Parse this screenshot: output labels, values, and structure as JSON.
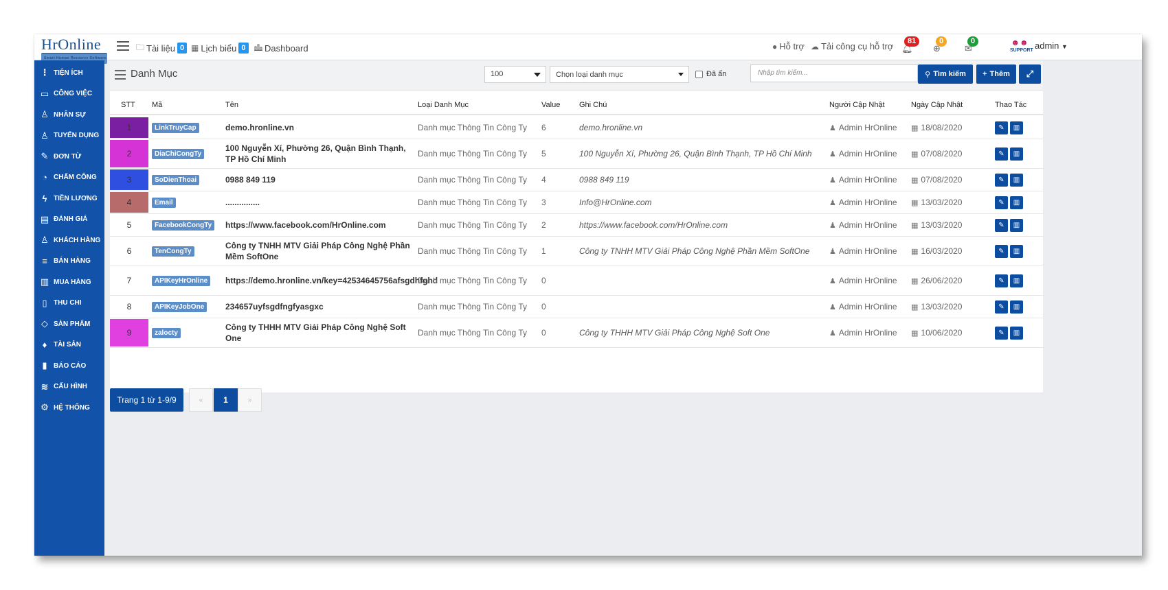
{
  "brand": {
    "logo": "HrOnline",
    "tagline": "Smart Human Resource Software"
  },
  "topnav": {
    "tai_lieu": "Tài liệu",
    "tai_lieu_count": "0",
    "lich_bieu": "Lịch biểu",
    "lich_bieu_count": "0",
    "dashboard": "Dashboard",
    "ho_tro": "Hỗ trợ",
    "tai_cong_cu": "Tải công cụ hỗ trợ",
    "notif_count": "81",
    "globe_count": "0",
    "mail_count": "0",
    "support_text": "SUPPORT",
    "user": "admin"
  },
  "sidebar": [
    {
      "label": "TIỆN ÍCH",
      "icon": "dots-icon"
    },
    {
      "label": "CÔNG VIỆC",
      "icon": "inbox-icon"
    },
    {
      "label": "NHÂN SỰ",
      "icon": "user-icon"
    },
    {
      "label": "TUYỂN DỤNG",
      "icon": "user-icon"
    },
    {
      "label": "ĐƠN TỪ",
      "icon": "edit-icon"
    },
    {
      "label": "CHẤM CÔNG",
      "icon": "clock-icon"
    },
    {
      "label": "TIỀN LƯƠNG",
      "icon": "bolt-icon"
    },
    {
      "label": "ĐÁNH GIÁ",
      "icon": "book-icon"
    },
    {
      "label": "KHÁCH HÀNG",
      "icon": "user-icon"
    },
    {
      "label": "BÁN HÀNG",
      "icon": "list-icon"
    },
    {
      "label": "MUA HÀNG",
      "icon": "columns-icon"
    },
    {
      "label": "THU CHI",
      "icon": "file-icon"
    },
    {
      "label": "SẢN PHẨM",
      "icon": "tag-icon"
    },
    {
      "label": "TÀI SẢN",
      "icon": "diamond-icon"
    },
    {
      "label": "BÁO CÁO",
      "icon": "bar-chart-icon"
    },
    {
      "label": "CẤU HÌNH",
      "icon": "layers-icon"
    },
    {
      "label": "HỆ THỐNG",
      "icon": "gear-icon"
    }
  ],
  "toolbar": {
    "title": "Danh Mục",
    "page_size": "100",
    "category_placeholder": "Chọn loại danh mục",
    "hidden_label": "Đã ẩn",
    "search_placeholder": "Nhập tìm kiếm...",
    "search_btn": "Tìm kiếm",
    "add_btn": "Thêm"
  },
  "table": {
    "headers": [
      "STT",
      "Mã",
      "Tên",
      "Loại Danh Mục",
      "Value",
      "Ghi Chú",
      "Người Cập Nhật",
      "Ngày Cập Nhật",
      "Thao Tác"
    ],
    "rows": [
      {
        "stt": "1",
        "color": "#7b1fa2",
        "ma": "LinkTruyCap",
        "ten": "demo.hronline.vn",
        "loai": "Danh mục Thông Tin Công Ty",
        "value": "6",
        "ghi": "demo.hronline.vn",
        "nguoi": "Admin HrOnline",
        "ngay": "18/08/2020"
      },
      {
        "stt": "2",
        "color": "#d633d6",
        "ma": "DiaChiCongTy",
        "ten": "100 Nguyễn Xí, Phường 26, Quận Bình Thạnh, TP Hồ Chí Minh",
        "loai": "Danh mục Thông Tin Công Ty",
        "value": "5",
        "ghi": "100 Nguyễn Xí, Phường 26, Quận Bình Thạnh, TP Hồ Chí Minh",
        "nguoi": "Admin HrOnline",
        "ngay": "07/08/2020"
      },
      {
        "stt": "3",
        "color": "#2f4fe0",
        "ma": "SoDienThoai",
        "ten": "0988 849 119",
        "loai": "Danh mục Thông Tin Công Ty",
        "value": "4",
        "ghi": "0988 849 119",
        "nguoi": "Admin HrOnline",
        "ngay": "07/08/2020"
      },
      {
        "stt": "4",
        "color": "#b86b6b",
        "ma": "Email",
        "ten": "...............",
        "loai": "Danh mục Thông Tin Công Ty",
        "value": "3",
        "ghi": "Info@HrOnline.com",
        "nguoi": "Admin HrOnline",
        "ngay": "13/03/2020"
      },
      {
        "stt": "5",
        "color": "",
        "ma": "FacebookCongTy",
        "ten": "https://www.facebook.com/HrOnline.com",
        "loai": "Danh mục Thông Tin Công Ty",
        "value": "2",
        "ghi": "https://www.facebook.com/HrOnline.com",
        "nguoi": "Admin HrOnline",
        "ngay": "13/03/2020"
      },
      {
        "stt": "6",
        "color": "",
        "ma": "TenCongTy",
        "ten": "Công ty TNHH MTV Giải Pháp Công Nghệ Phần Mềm SoftOne",
        "loai": "Danh mục Thông Tin Công Ty",
        "value": "1",
        "ghi": "Công ty TNHH MTV Giải Pháp Công Nghệ Phần Mềm SoftOne",
        "nguoi": "Admin HrOnline",
        "ngay": "16/03/2020"
      },
      {
        "stt": "7",
        "color": "",
        "ma": "APIKeyHrOnline",
        "ten": "https://demo.hronline.vn/key=42534645756afsgdhfghd",
        "loai": "Danh mục Thông Tin Công Ty",
        "value": "0",
        "ghi": "",
        "nguoi": "Admin HrOnline",
        "ngay": "26/06/2020"
      },
      {
        "stt": "8",
        "color": "",
        "ma": "APIKeyJobOne",
        "ten": "234657uyfsgdfngfyasgxc",
        "loai": "Danh mục Thông Tin Công Ty",
        "value": "0",
        "ghi": "",
        "nguoi": "Admin HrOnline",
        "ngay": "13/03/2020"
      },
      {
        "stt": "9",
        "color": "#e040e0",
        "ma": "zalocty",
        "ten": "Công ty THHH MTV Giải Pháp Công Nghệ Soft One",
        "loai": "Danh mục Thông Tin Công Ty",
        "value": "0",
        "ghi": "Công ty THHH MTV Giải Pháp Công Nghệ Soft One",
        "nguoi": "Admin HrOnline",
        "ngay": "10/06/2020"
      }
    ]
  },
  "pagination": {
    "info": "Trang 1 từ 1-9/9",
    "prev": "«",
    "current": "1",
    "next": "»"
  }
}
